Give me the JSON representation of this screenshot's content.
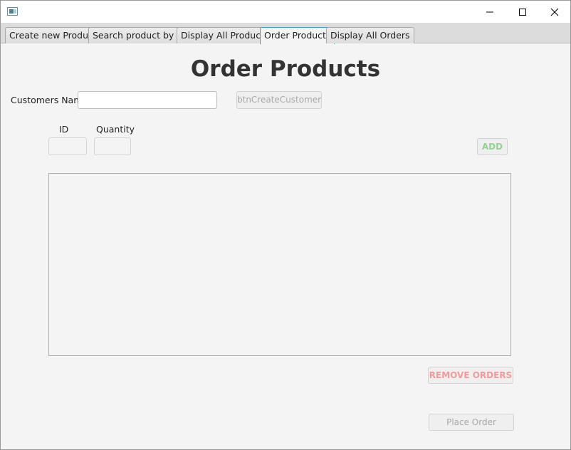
{
  "tabs": [
    {
      "label": "Create new Product"
    },
    {
      "label": "Search product by ID"
    },
    {
      "label": "Display All Products"
    },
    {
      "label": "Order Products",
      "active": true
    },
    {
      "label": "Display All Orders"
    }
  ],
  "page": {
    "title": "Order Products",
    "customer_name_label": "Customers Name",
    "customer_name_value": "",
    "create_customer_button": "btnCreateCustomer",
    "id_label": "ID",
    "id_value": "",
    "quantity_label": "Quantity",
    "quantity_value": "",
    "add_button": "ADD",
    "order_items": [],
    "remove_orders_button": "REMOVE ORDERS",
    "place_order_button": "Place Order"
  },
  "icons": {
    "app": "java-app-icon",
    "minimize": "minimize-icon",
    "maximize": "maximize-icon",
    "close": "close-icon"
  },
  "colors": {
    "active_tab_border": "#3c9ad6",
    "add_text": "#8fd68f",
    "remove_text": "#f09a9a",
    "disabled_text": "#a8a8a8"
  }
}
